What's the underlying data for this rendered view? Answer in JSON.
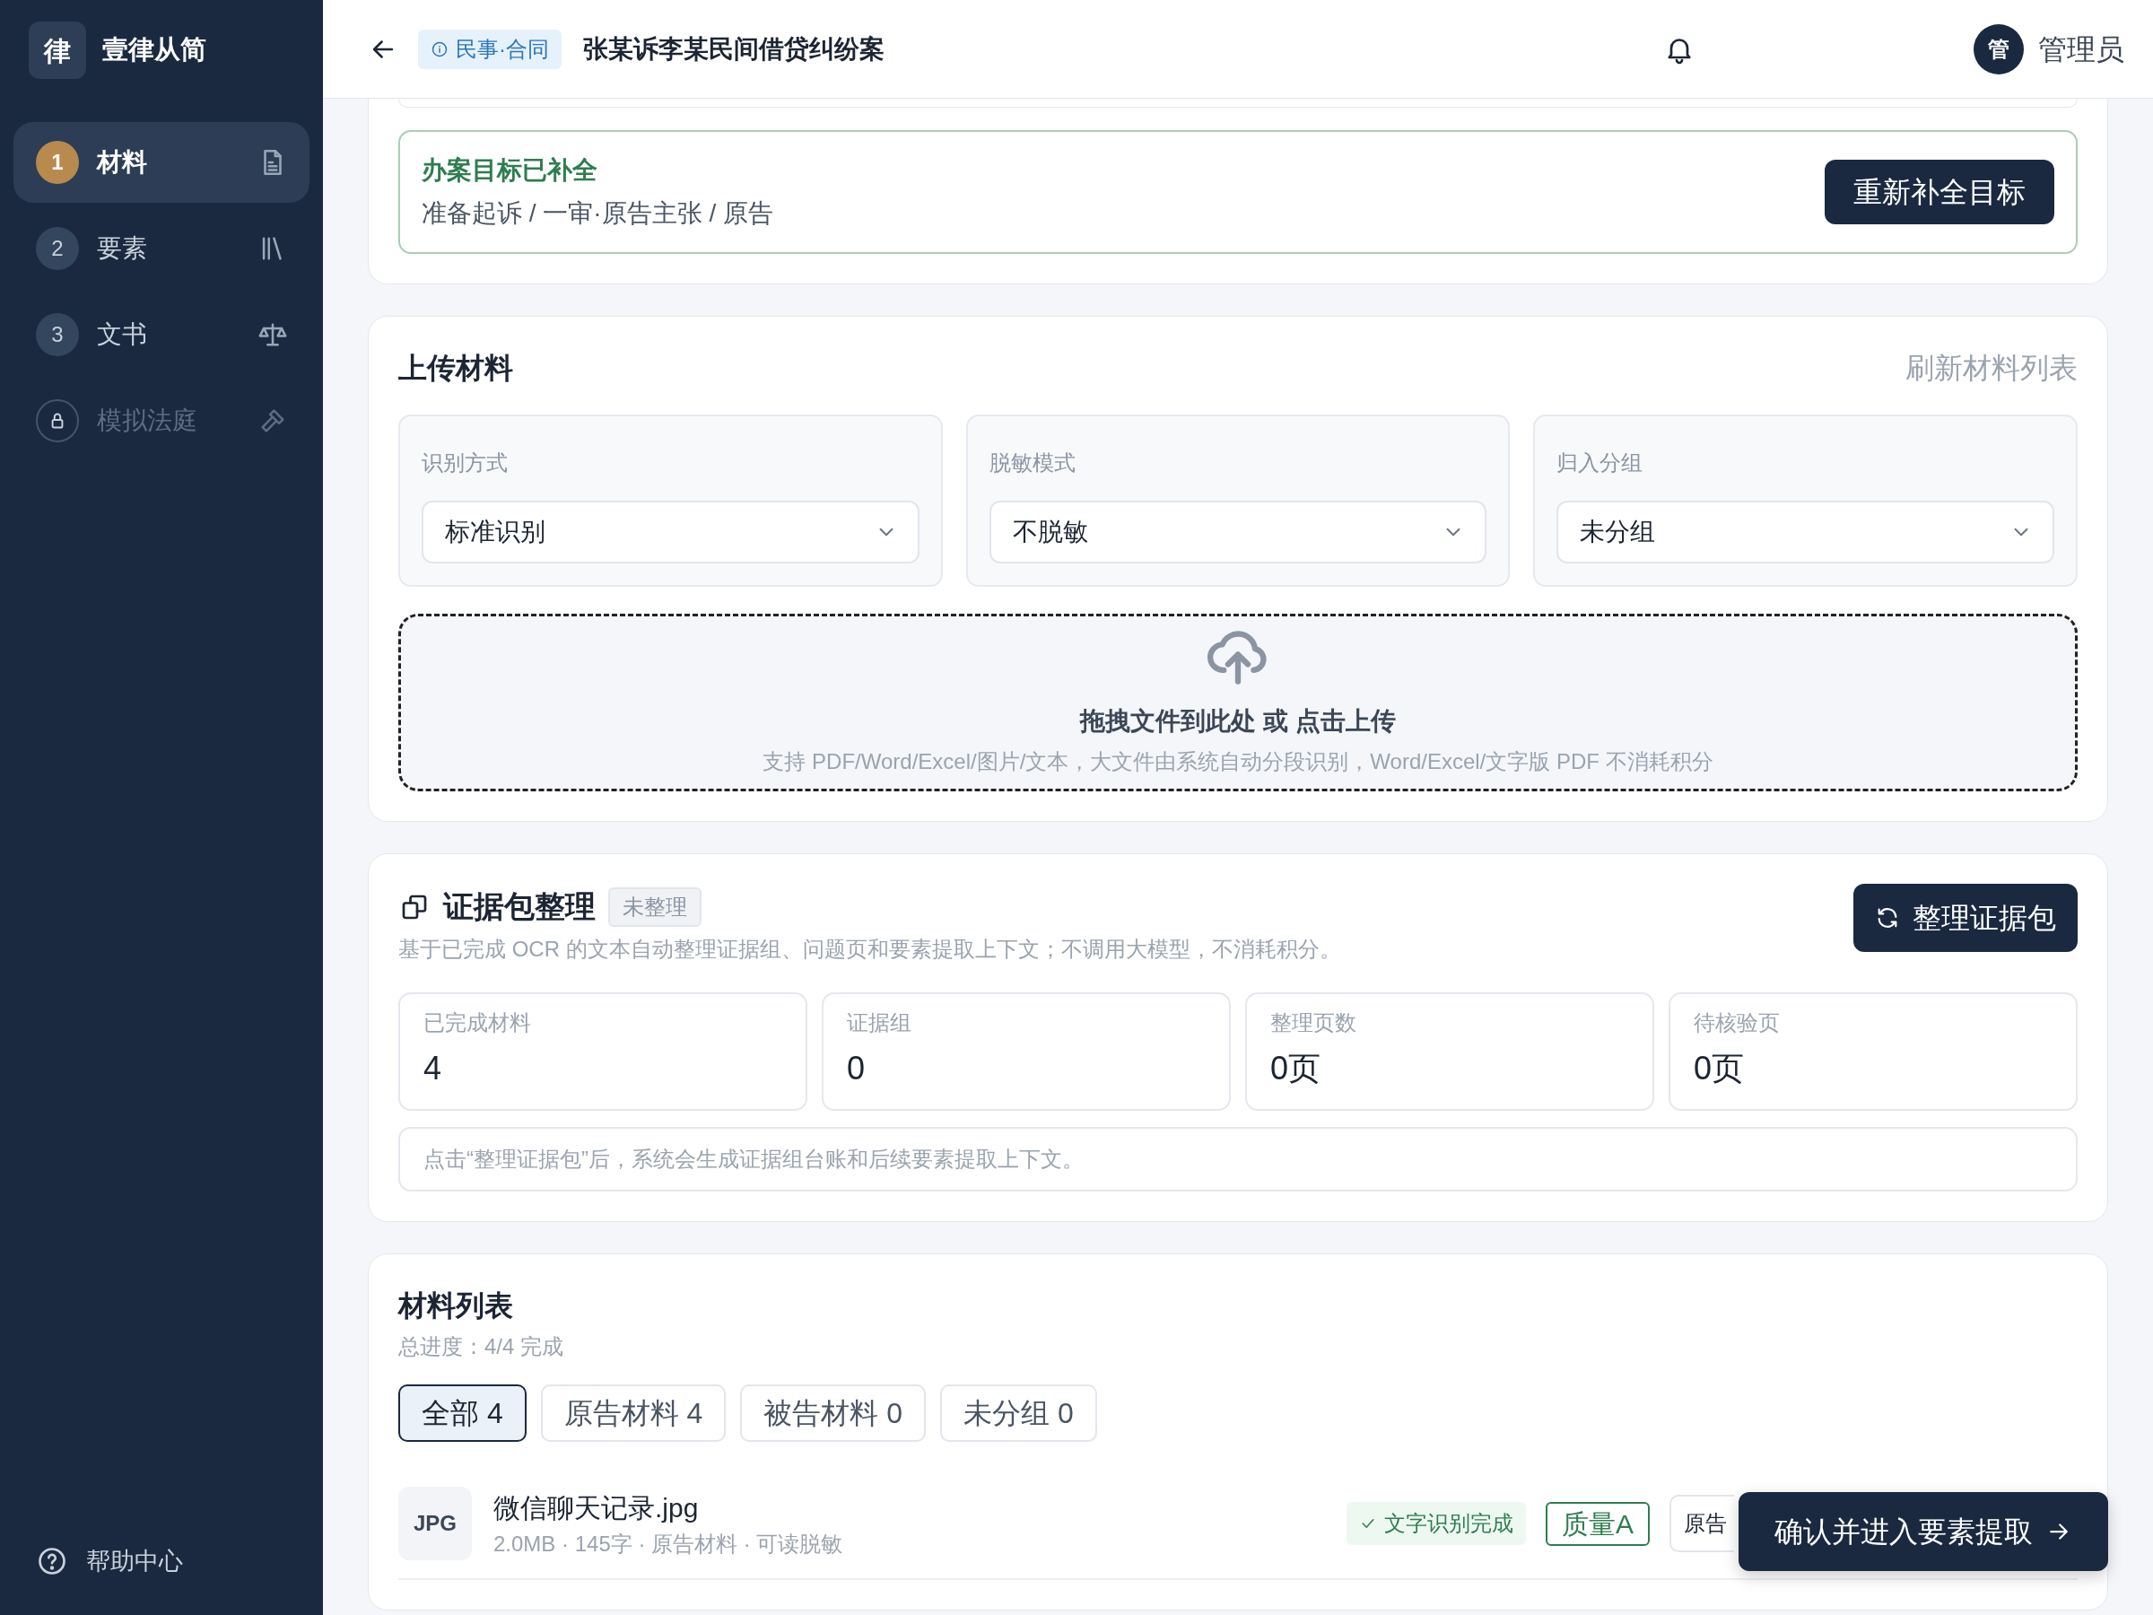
{
  "sidebar": {
    "logo_mark": "律",
    "brand": "壹律从简",
    "steps": [
      {
        "number": "1",
        "label": "材料",
        "selected": true,
        "locked": false
      },
      {
        "number": "2",
        "label": "要素",
        "selected": false,
        "locked": false
      },
      {
        "number": "3",
        "label": "文书",
        "selected": false,
        "locked": false
      },
      {
        "label": "模拟法庭",
        "selected": false,
        "locked": true
      }
    ],
    "help": "帮助中心"
  },
  "header": {
    "tag": "民事·合同",
    "title": "张某诉李某民间借贷纠纷案",
    "avatar": "管",
    "user": "管理员"
  },
  "goal": {
    "title": "办案目标已补全",
    "path": "准备起诉 / 一审·原告主张 / 原告",
    "button": "重新补全目标"
  },
  "upload": {
    "title": "上传材料",
    "refresh": "刷新材料列表",
    "selects": [
      {
        "label": "识别方式",
        "value": "标准识别"
      },
      {
        "label": "脱敏模式",
        "value": "不脱敏"
      },
      {
        "label": "归入分组",
        "value": "未分组"
      }
    ],
    "drop_title": "拖拽文件到此处 或 点击上传",
    "drop_hint": "支持 PDF/Word/Excel/图片/文本，大文件由系统自动分段识别，Word/Excel/文字版 PDF 不消耗积分"
  },
  "evidence": {
    "title": "证据包整理",
    "status": "未整理",
    "description": "基于已完成 OCR 的文本自动整理证据组、问题页和要素提取上下文；不调用大模型，不消耗积分。",
    "button": "整理证据包",
    "stats": [
      {
        "label": "已完成材料",
        "value": "4"
      },
      {
        "label": "证据组",
        "value": "0"
      },
      {
        "label": "整理页数",
        "value": "0页"
      },
      {
        "label": "待核验页",
        "value": "0页"
      }
    ],
    "note": "点击“整理证据包”后，系统会生成证据组台账和后续要素提取上下文。"
  },
  "materials": {
    "title": "材料列表",
    "progress": "总进度：4/4 完成",
    "filters": [
      {
        "label": "全部 4",
        "selected": true
      },
      {
        "label": "原告材料 4",
        "selected": false
      },
      {
        "label": "被告材料 0",
        "selected": false
      },
      {
        "label": "未分组 0",
        "selected": false
      }
    ],
    "rows": [
      {
        "type": "JPG",
        "name": "微信聊天记录.jpg",
        "meta": "2.0MB · 145字 · 原告材料 · 可读脱敏",
        "status": "文字识别完成",
        "quality": "质量A",
        "group": "原告"
      }
    ]
  },
  "confirm_button": "确认并进入要素提取"
}
